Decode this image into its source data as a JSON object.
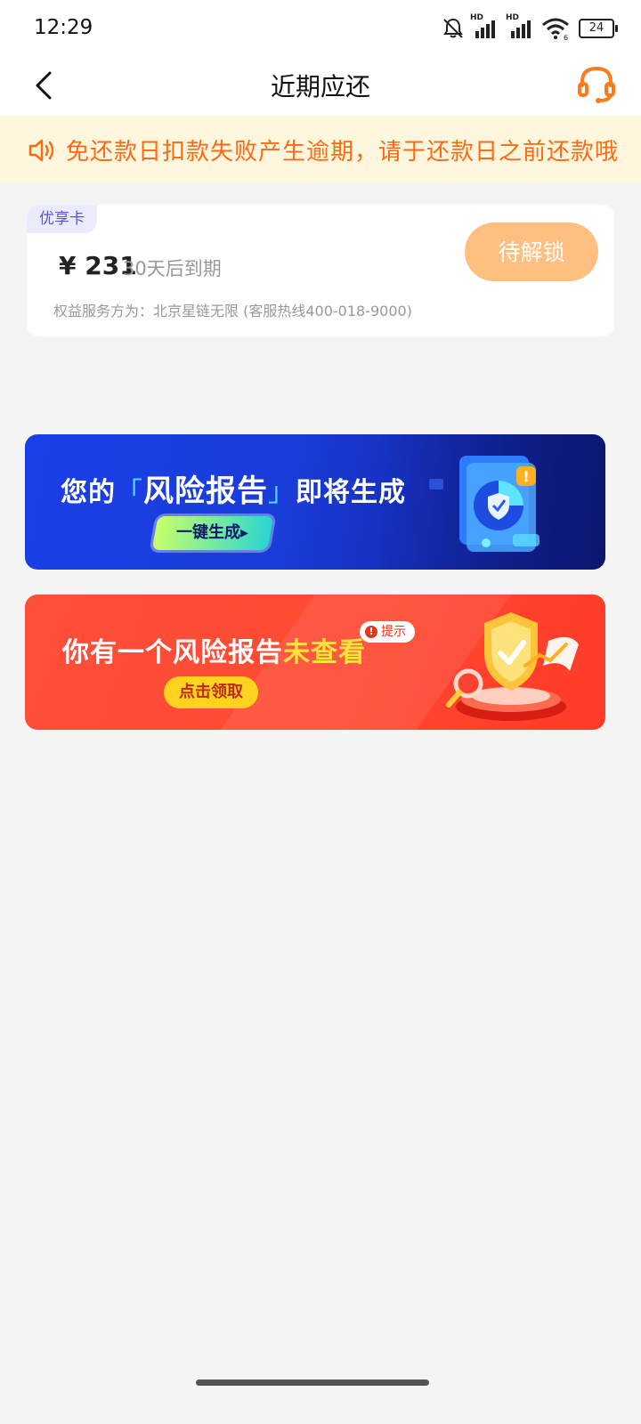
{
  "status_bar": {
    "time": "12:29",
    "hd_label": "HD",
    "wifi_sub": "6",
    "battery": "24"
  },
  "header": {
    "title": "近期应还"
  },
  "notice": {
    "text": "免还款日扣款失败产生逾期，请于还款日之前还款哦"
  },
  "card": {
    "tag": "优享卡",
    "amount": "¥ 231",
    "due": "30天后到期",
    "provider": "权益服务方为：北京星链无限 (客服热线400-018-9000)",
    "button": "待解锁"
  },
  "banner_report_generate": {
    "prefix": "您的",
    "highlight": "风险报告",
    "suffix": "即将生成",
    "button": "一键生成"
  },
  "banner_report_unviewed": {
    "prefix": "你有一个风险报告",
    "highlight": "未查看",
    "badge": "提示",
    "button": "点击领取"
  },
  "colors": {
    "accent_orange": "#ff6a13",
    "unlock_button": "#ffbf80",
    "tag_purple": "#5b55d6",
    "banner_blue": "#1a3fe8",
    "banner_red": "#ff4e3a",
    "claim_yellow": "#ffd21f"
  }
}
